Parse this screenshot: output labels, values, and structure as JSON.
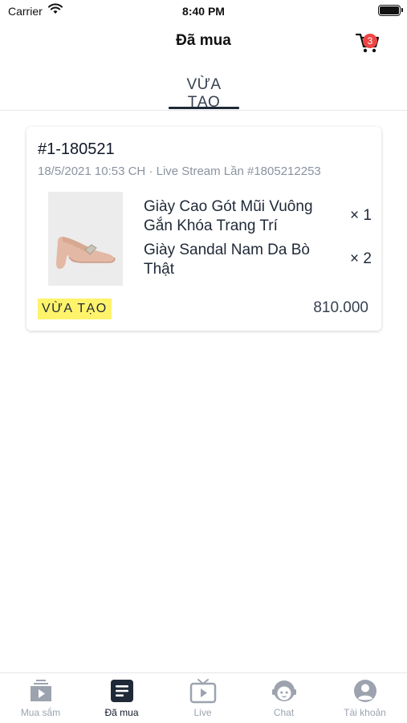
{
  "status_bar": {
    "carrier": "Carrier",
    "time": "8:40 PM"
  },
  "header": {
    "title": "Đã mua",
    "cart_count": "3"
  },
  "tabs": [
    {
      "label": "VỪA TẠO",
      "active": true
    }
  ],
  "order": {
    "id": "#1-180521",
    "meta": "18/5/2021 10:53 CH · Live Stream Lần #1805212253",
    "items": [
      {
        "name": "Giày Cao Gót Mũi Vuông Gắn Khóa Trang Trí",
        "qty": "× 1"
      },
      {
        "name": "Giày Sandal Nam Da Bò Thật",
        "qty": "× 2"
      }
    ],
    "status": "VỪA TẠO",
    "total": "810.000"
  },
  "tabbar": [
    {
      "label": "Mua sắm",
      "icon": "shopping-video-icon"
    },
    {
      "label": "Đã mua",
      "icon": "document-list-icon"
    },
    {
      "label": "Live",
      "icon": "tv-play-icon"
    },
    {
      "label": "Chat",
      "icon": "chat-face-icon"
    },
    {
      "label": "Tài khoản",
      "icon": "user-icon"
    }
  ],
  "colors": {
    "badge_bg": "#fef36b",
    "cart_badge": "#ef4444",
    "active_tab": "#1f2937",
    "inactive": "#9ca3af"
  }
}
